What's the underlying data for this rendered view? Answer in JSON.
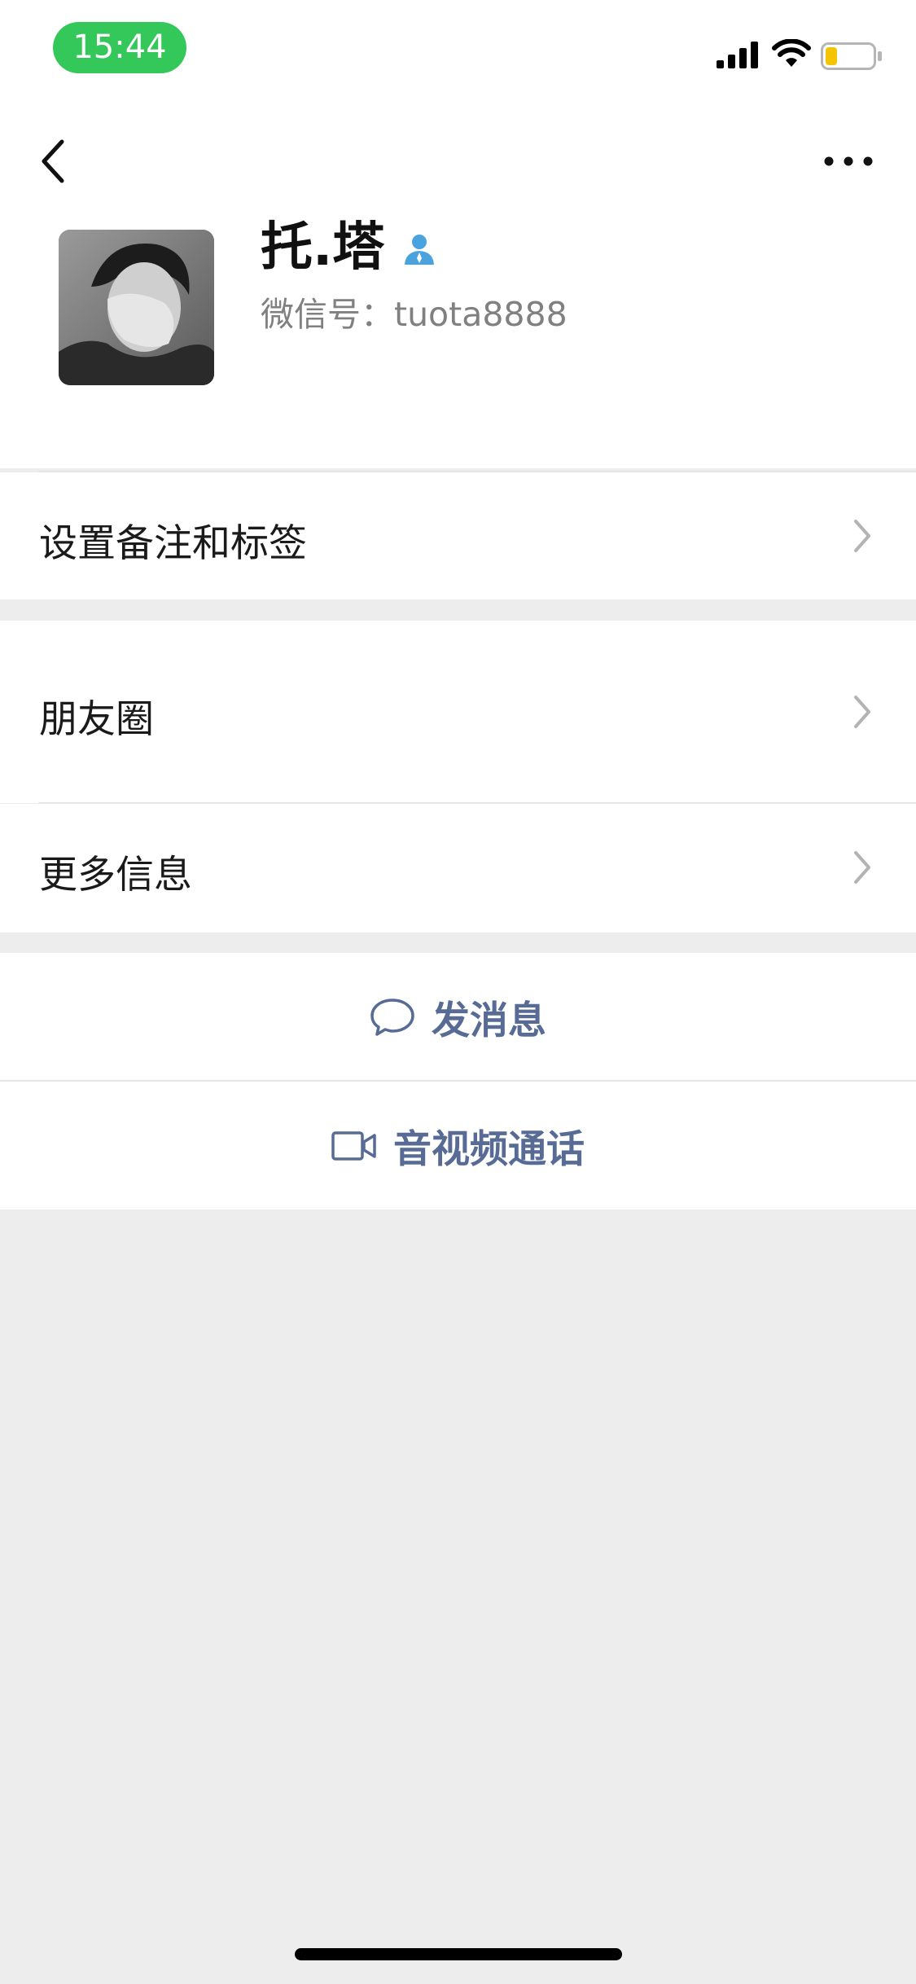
{
  "status_bar": {
    "time": "15:44",
    "time_pill_color": "#34c759",
    "icons": [
      "signal-icon",
      "wifi-icon",
      "battery-icon"
    ],
    "battery_level_fraction": 0.25,
    "battery_fill_color": "#f5c400"
  },
  "nav": {
    "back_icon": "chevron-left-icon",
    "more_icon": "more-dots-icon"
  },
  "profile": {
    "name": "托.塔",
    "badge_icon": "contact-person-icon",
    "badge_color": "#4aa3df",
    "wechat_id_text": "微信号：tuota8888"
  },
  "rows": {
    "remark": "设置备注和标签",
    "moments": "朋友圈",
    "more_info": "更多信息"
  },
  "actions": {
    "message": "发消息",
    "message_icon": "chat-bubble-icon",
    "call": "音视频通话",
    "call_icon": "video-camera-icon",
    "accent_color": "#576b95"
  }
}
